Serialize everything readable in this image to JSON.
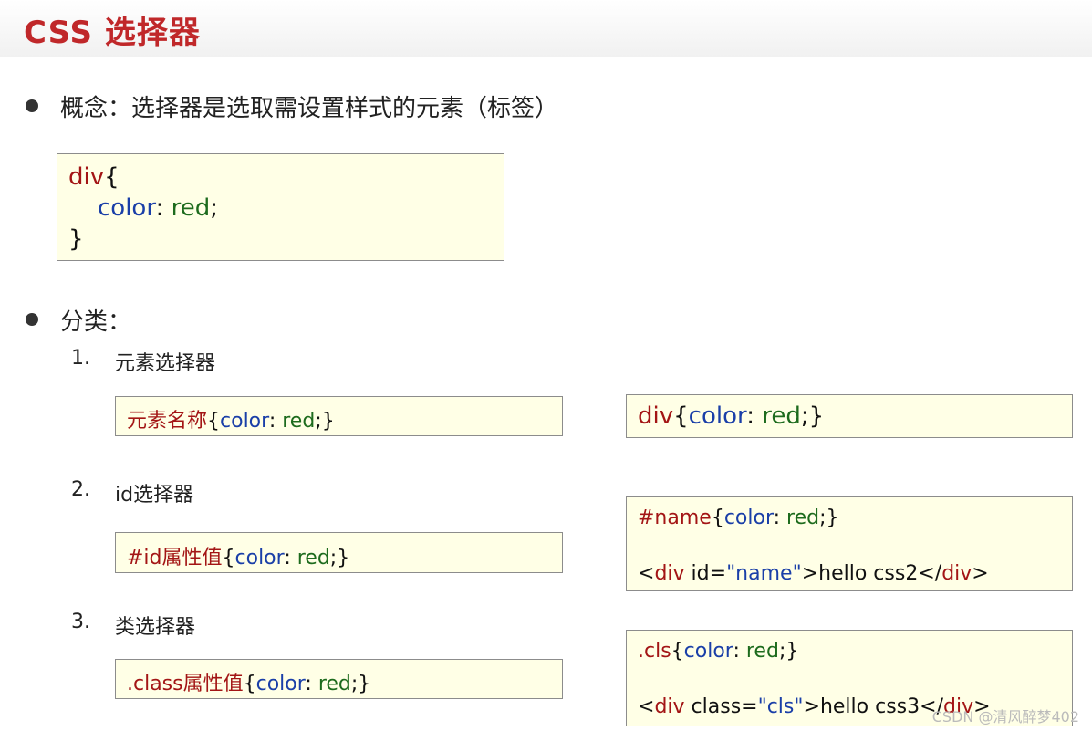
{
  "header": {
    "title": "CSS 选择器"
  },
  "concept": {
    "text": "概念：选择器是选取需设置样式的元素（标签）",
    "code": {
      "sel": "div",
      "open": "{",
      "prop": "color",
      "colon": ":",
      "value": "red",
      "semi": ";",
      "close": "}"
    }
  },
  "category": {
    "label": "分类：",
    "items": [
      {
        "num": "1.",
        "name": "元素选择器",
        "syntax": {
          "sel": "元素名称",
          "open": "{",
          "prop": "color",
          "colon": ": ",
          "value": "red",
          "tail": ";}"
        },
        "example": {
          "sel": "div",
          "open": "{",
          "prop": "color",
          "colon": ": ",
          "value": "red",
          "tail": ";}"
        }
      },
      {
        "num": "2.",
        "name": "id选择器",
        "syntax": {
          "sel": "#id属性值",
          "open": "{",
          "prop": "color",
          "colon": ": ",
          "value": "red",
          "tail": ";}"
        },
        "example": {
          "css": {
            "sel": "#name",
            "open": "{",
            "prop": "color",
            "colon": ": ",
            "value": "red",
            "tail": ";}"
          },
          "html": {
            "lt": "<",
            "tag": "div",
            "attr": " id=",
            "attrval": "\"name\"",
            "gt": ">",
            "content": "hello css2",
            "endlt": "</",
            "endtag": "div",
            "endgt": ">"
          }
        }
      },
      {
        "num": "3.",
        "name": "类选择器",
        "syntax": {
          "sel": ".class属性值",
          "open": "{",
          "prop": "color",
          "colon": ": ",
          "value": "red",
          "tail": ";}"
        },
        "example": {
          "css": {
            "sel": ".cls",
            "open": "{",
            "prop": "color",
            "colon": ": ",
            "value": "red",
            "tail": ";}"
          },
          "html": {
            "lt": "<",
            "tag": "div",
            "attr": " class=",
            "attrval": "\"cls\"",
            "gt": ">",
            "content": "hello css3",
            "endlt": "</",
            "endtag": "div",
            "endgt": ">"
          }
        }
      }
    ]
  },
  "watermark": "CSDN @清风醉梦402",
  "colors": {
    "title": "#c0282a",
    "selector": "#a31515",
    "property": "#1a3fa8",
    "value": "#1d6b1d",
    "code_bg": "#ffffe6"
  }
}
